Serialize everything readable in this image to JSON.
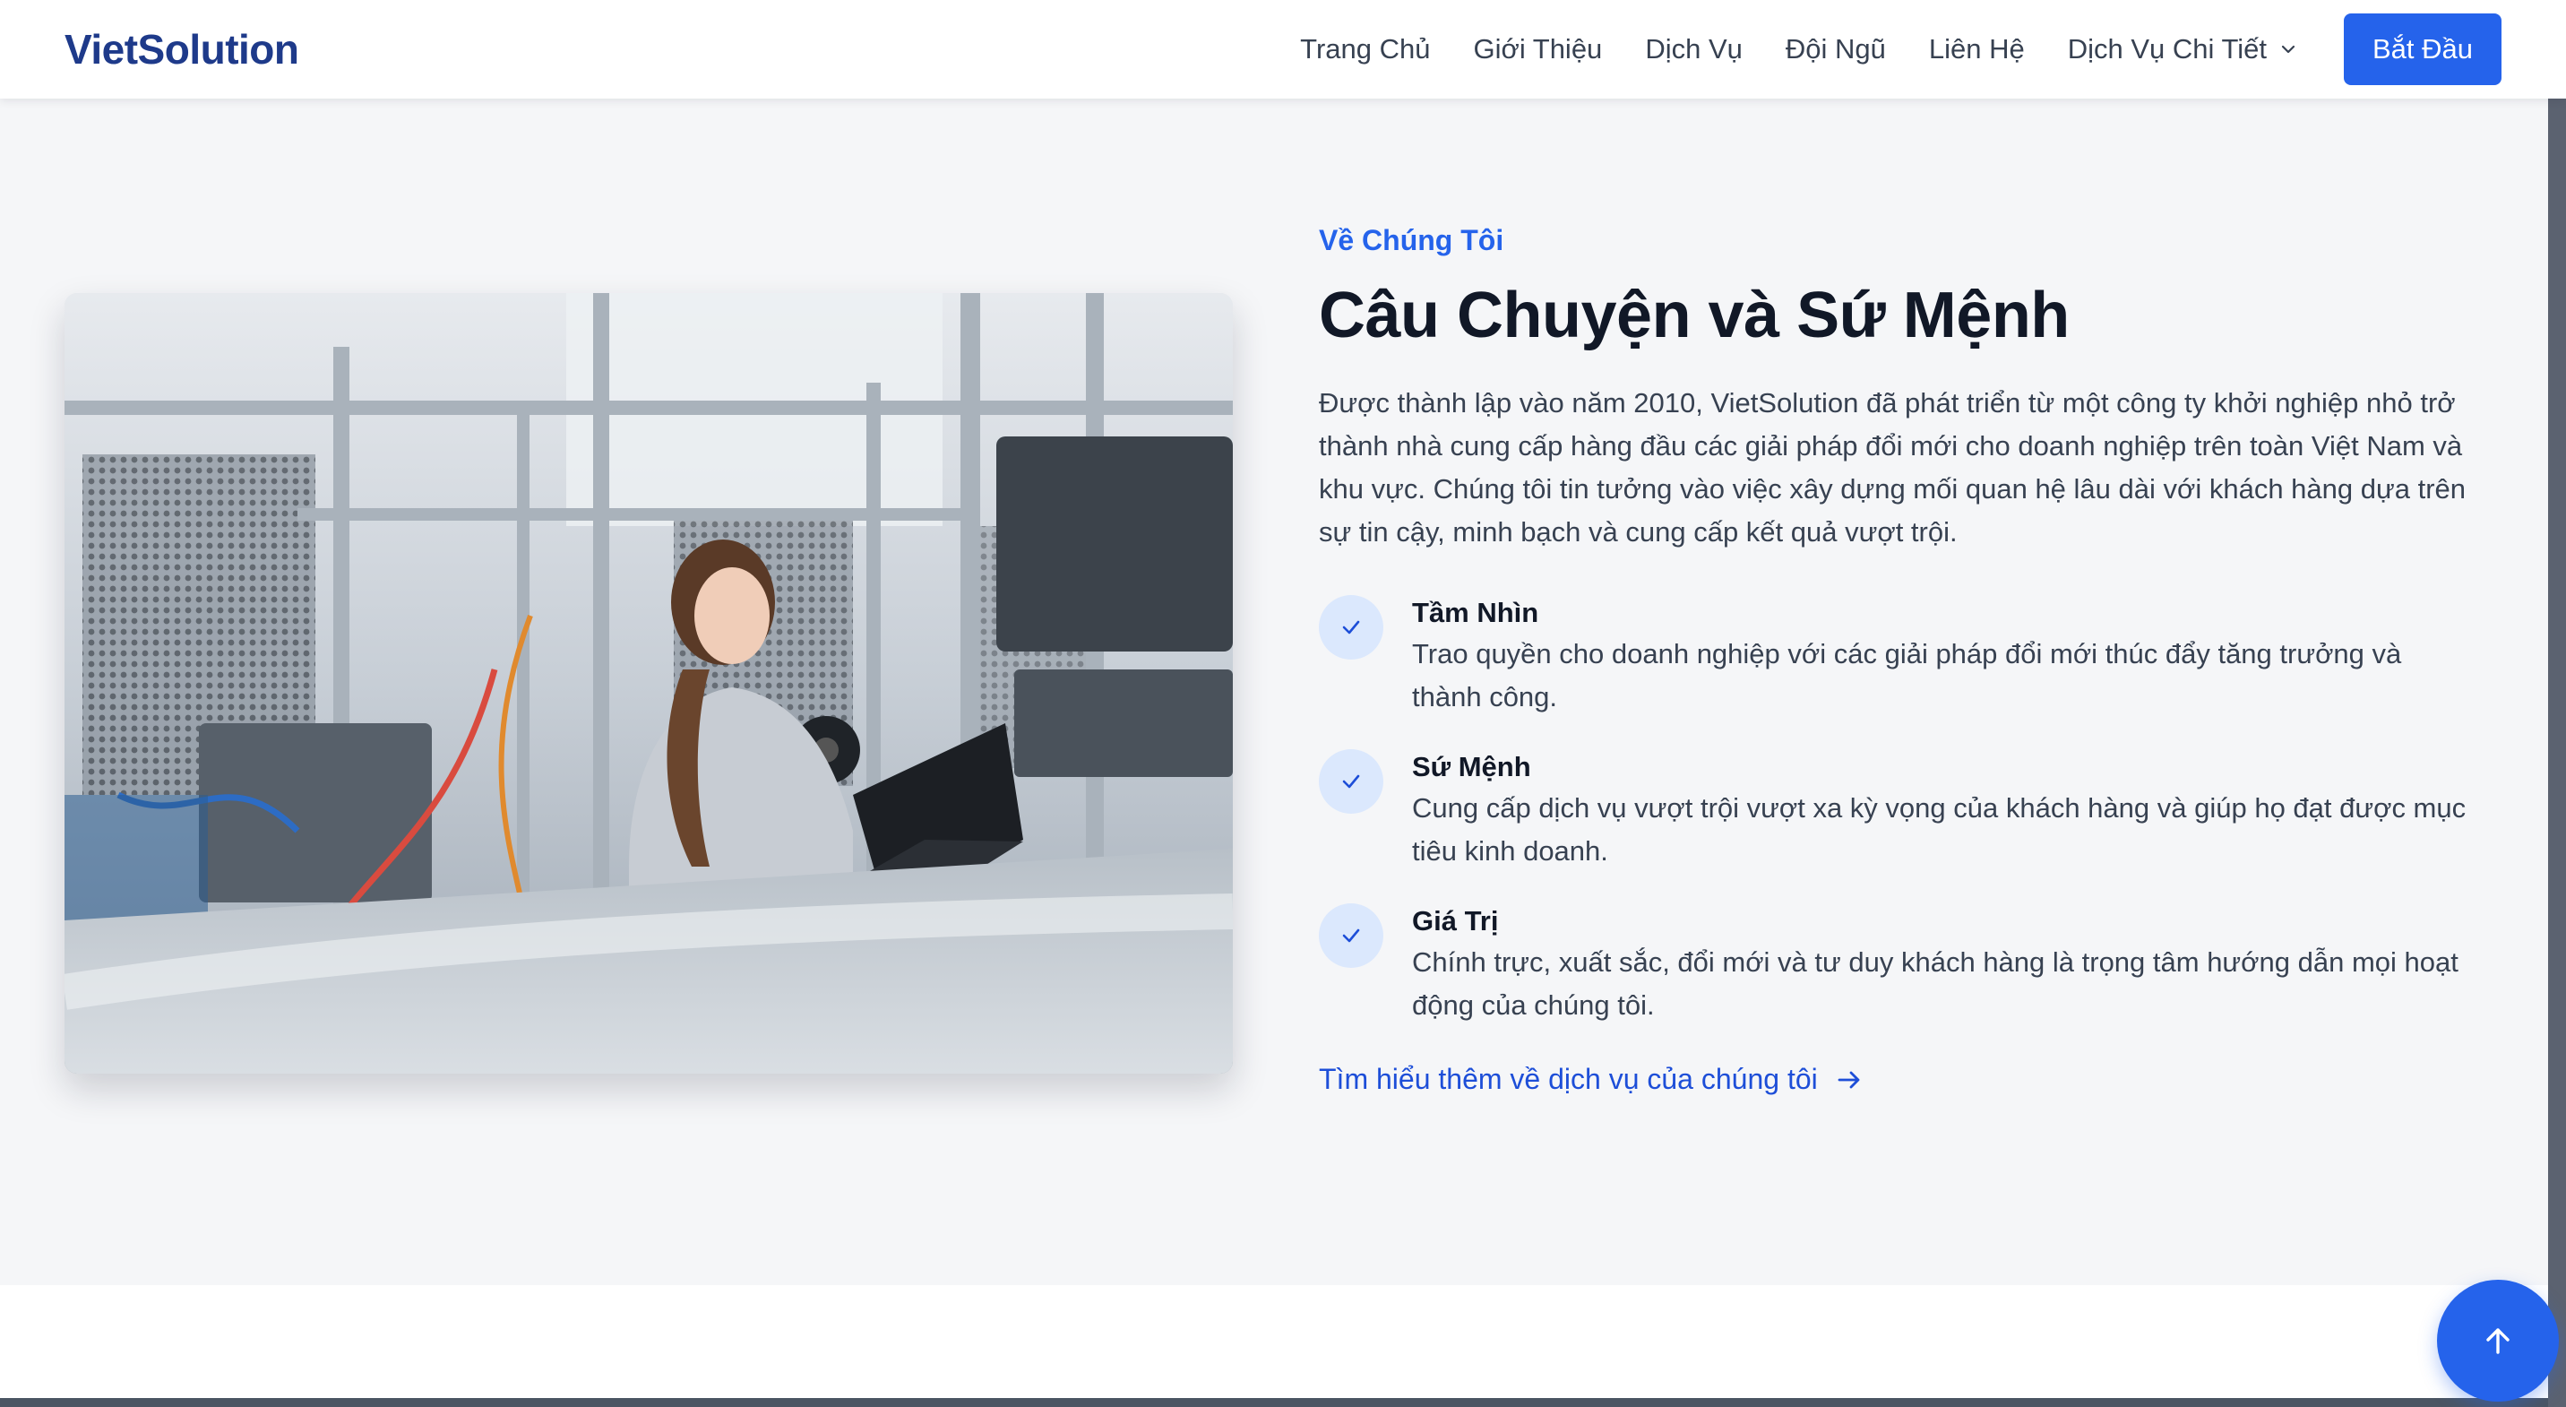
{
  "header": {
    "brand": "VietSolution",
    "nav": [
      "Trang Chủ",
      "Giới Thiệu",
      "Dịch Vụ",
      "Đội Ngũ",
      "Liên Hệ",
      "Dịch Vụ Chi Tiết"
    ],
    "cta_label": "Bắt Đầu"
  },
  "about": {
    "eyebrow": "Về Chúng Tôi",
    "title": "Câu Chuyện và Sứ Mệnh",
    "description": "Được thành lập vào năm 2010, VietSolution đã phát triển từ một công ty khởi nghiệp nhỏ trở thành nhà cung cấp hàng đầu các giải pháp đổi mới cho doanh nghiệp trên toàn Việt Nam và khu vực. Chúng tôi tin tưởng vào việc xây dựng mối quan hệ lâu dài với khách hàng dựa trên sự tin cậy, minh bạch và cung cấp kết quả vượt trội.",
    "features": [
      {
        "title": "Tầm Nhìn",
        "text": "Trao quyền cho doanh nghiệp với các giải pháp đổi mới thúc đẩy tăng trưởng và thành công."
      },
      {
        "title": "Sứ Mệnh",
        "text": "Cung cấp dịch vụ vượt trội vượt xa kỳ vọng của khách hàng và giúp họ đạt được mục tiêu kinh doanh."
      },
      {
        "title": "Giá Trị",
        "text": "Chính trực, xuất sắc, đổi mới và tư duy khách hàng là trọng tâm hướng dẫn mọi hoạt động của chúng tôi."
      }
    ],
    "learn_more": "Tìm hiểu thêm về dịch vụ của chúng tôi"
  },
  "icons": {
    "feature": "check-icon",
    "learn_more": "arrow-right-icon",
    "dropdown": "chevron-down-icon",
    "back_to_top": "arrow-up-icon"
  },
  "colors": {
    "brand": "#1e3a8a",
    "accent": "#2563eb",
    "check_bg": "#dbe8fd",
    "section_bg": "#f5f6f8"
  }
}
